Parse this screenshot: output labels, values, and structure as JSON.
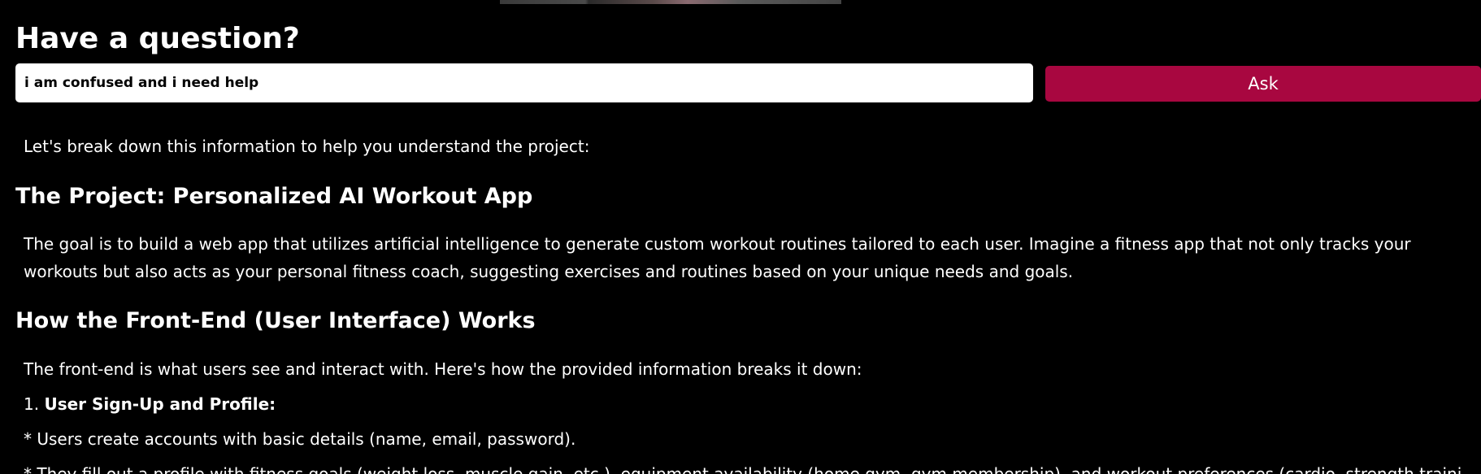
{
  "question_section": {
    "title": "Have a question?",
    "input_value": "i am confused and i need help",
    "ask_label": "Ask"
  },
  "answer": {
    "intro": "Let's break down this information to help you understand the project:",
    "section1_title": "The Project: Personalized AI Workout App",
    "section1_body": "The goal is to build a web app that utilizes artificial intelligence to generate custom workout routines tailored to each user. Imagine a fitness app that not only tracks your workouts but also acts as your personal fitness coach, suggesting exercises and routines based on your unique needs and goals.",
    "section2_title": "How the Front-End (User Interface) Works",
    "section2_body": "The front-end is what users see and interact with. Here's how the provided information breaks it down:",
    "item1_number": "1.",
    "item1_title": "User Sign-Up and Profile:",
    "bullet1": "* Users create accounts with basic details (name, email, password).",
    "bullet2": "* They fill out a profile with fitness goals (weight loss, muscle gain, etc.), equipment availability (home gym, gym membership), and workout preferences (cardio, strength training, etc.)."
  },
  "colors": {
    "background": "#000000",
    "ask_button": "#a80740",
    "text": "#ffffff"
  }
}
